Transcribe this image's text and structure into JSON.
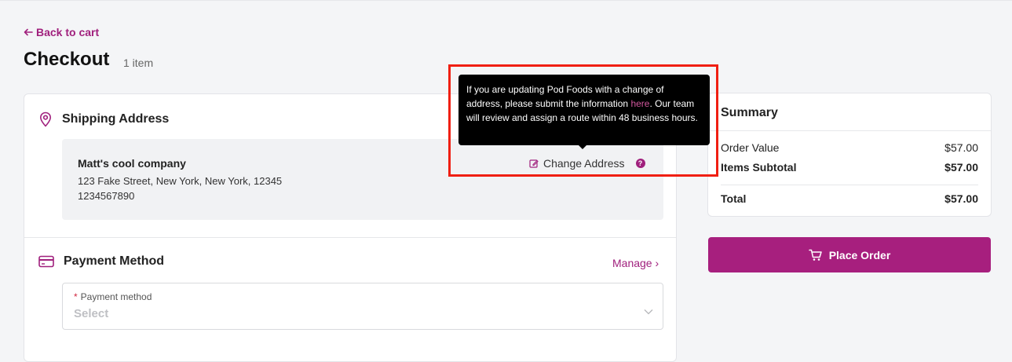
{
  "nav": {
    "back_label": "Back to cart"
  },
  "page": {
    "title": "Checkout",
    "item_count": "1 item"
  },
  "shipping": {
    "header": "Shipping Address",
    "icon": "location-pin-icon",
    "name": "Matt's cool company",
    "street": "123 Fake Street, New York, New York, 12345",
    "phone": "1234567890",
    "change_label": "Change Address"
  },
  "tooltip": {
    "text_before": "If you are updating Pod Foods with a change of address, please submit the information ",
    "link_text": "here",
    "text_after": ". Our team will review and assign a route within 48 business hours."
  },
  "payment": {
    "header": "Payment Method",
    "icon": "credit-card-icon",
    "manage_label": "Manage",
    "field_required_mark": "*",
    "field_label": "Payment method",
    "field_placeholder": "Select"
  },
  "summary": {
    "title": "Summary",
    "order_value_label": "Order Value",
    "order_value": "$57.00",
    "items_subtotal_label": "Items Subtotal",
    "items_subtotal": "$57.00",
    "total_label": "Total",
    "total": "$57.00"
  },
  "actions": {
    "place_order_label": "Place Order"
  },
  "colors": {
    "brand": "#a71f7e",
    "highlight": "#f01f12"
  }
}
